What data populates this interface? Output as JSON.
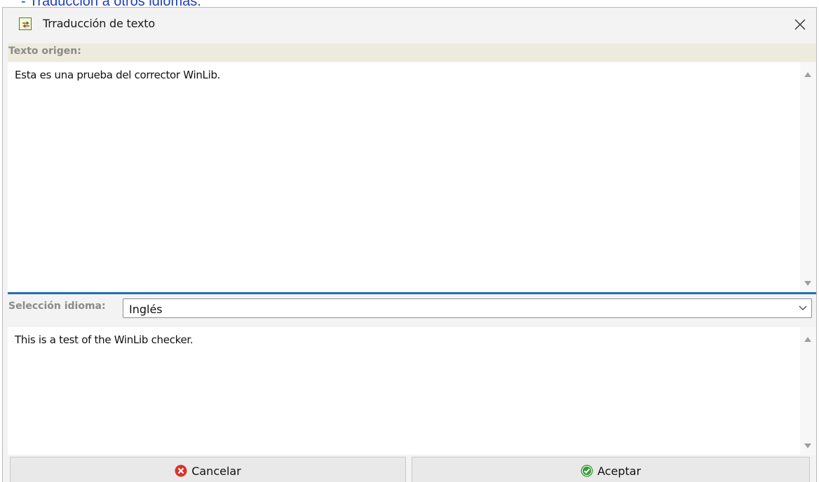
{
  "background": {
    "link_text": "- Traducción a otros idiomas."
  },
  "window": {
    "title": "Trraducción de texto",
    "app_icon": "translate-app-icon",
    "close_icon": "close-icon"
  },
  "source": {
    "label": "Texto origen:",
    "text": "Esta es una prueba del corrector WinLib."
  },
  "language": {
    "label": "Selección idioma:",
    "selected": "Inglés"
  },
  "target": {
    "text": "This is a test of the WinLib checker."
  },
  "buttons": {
    "cancel_label": "Cancelar",
    "cancel_icon": "cancel-x-icon",
    "ok_label": "Aceptar",
    "ok_icon": "check-icon"
  },
  "colors": {
    "accent_splitter": "#1f6fb6",
    "label_bar": "#ecebdd",
    "cancel_red": "#d9342b",
    "ok_green": "#3d9b3d"
  }
}
